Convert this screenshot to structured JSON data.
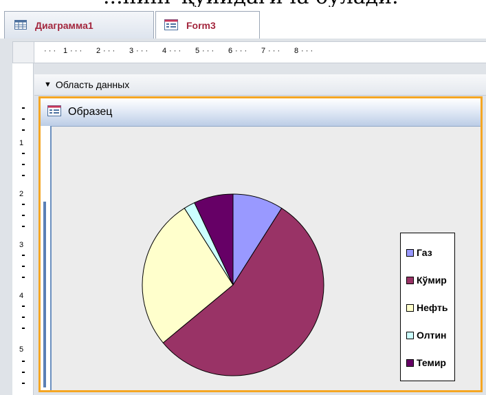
{
  "caption_fragment": "...нинг қуйидагича бўлади.",
  "tabs": [
    {
      "label": "Диаграмма1",
      "icon": "table-icon"
    },
    {
      "label": "Form3",
      "icon": "form-icon"
    }
  ],
  "ruler": {
    "horizontal": [
      "1",
      "2",
      "3",
      "4",
      "5",
      "6",
      "7",
      "8"
    ],
    "vertical": [
      "1",
      "2",
      "3",
      "4",
      "5"
    ]
  },
  "section": {
    "label": "Область данных",
    "icon": "section-arrow-icon"
  },
  "subform": {
    "title": "Образец",
    "icon": "form-icon"
  },
  "colors": {
    "accent": "#f5a623",
    "tab_text": "#a3263d"
  },
  "chart_data": {
    "type": "pie",
    "categories": [
      "Газ",
      "Кўмир",
      "Нефть",
      "Олтин",
      "Темир"
    ],
    "values": [
      9,
      55,
      27,
      2,
      7
    ],
    "colors": [
      "#9999ff",
      "#993366",
      "#ffffcc",
      "#ccffff",
      "#660066"
    ],
    "legend": "right"
  }
}
